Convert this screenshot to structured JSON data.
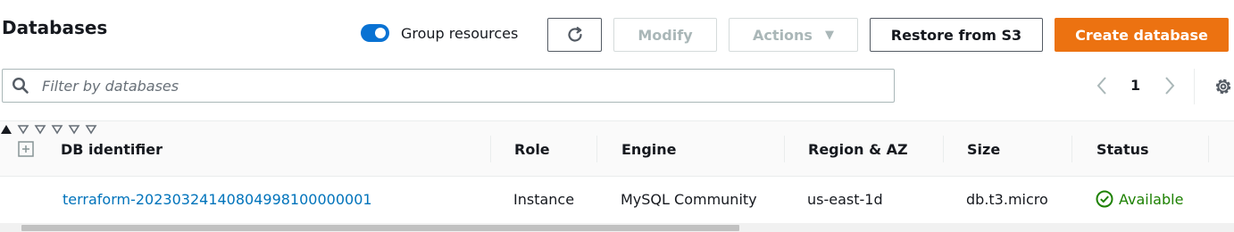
{
  "page": {
    "title": "Databases"
  },
  "toolbar": {
    "group_resources_label": "Group resources",
    "group_resources_on": true,
    "refresh_icon": "refresh-icon",
    "modify_label": "Modify",
    "actions_label": "Actions",
    "restore_label": "Restore from S3",
    "create_label": "Create database"
  },
  "search": {
    "placeholder": "Filter by databases"
  },
  "pagination": {
    "current_page": "1"
  },
  "table": {
    "columns": [
      {
        "label": "DB identifier",
        "sort": "ascending"
      },
      {
        "label": "Role",
        "sort": "none"
      },
      {
        "label": "Engine",
        "sort": "none"
      },
      {
        "label": "Region & AZ",
        "sort": "none"
      },
      {
        "label": "Size",
        "sort": "none"
      },
      {
        "label": "Status",
        "sort": "none"
      }
    ],
    "rows": [
      {
        "identifier": "terraform-20230324140804998100000001",
        "role": "Instance",
        "engine": "MySQL Community",
        "region": "us-east-1d",
        "size": "db.t3.micro",
        "status": "Available"
      }
    ]
  },
  "colors": {
    "primary": "#ec7211",
    "toggle": "#0972d3",
    "link": "#0073bb",
    "status_ok": "#1d8102"
  }
}
